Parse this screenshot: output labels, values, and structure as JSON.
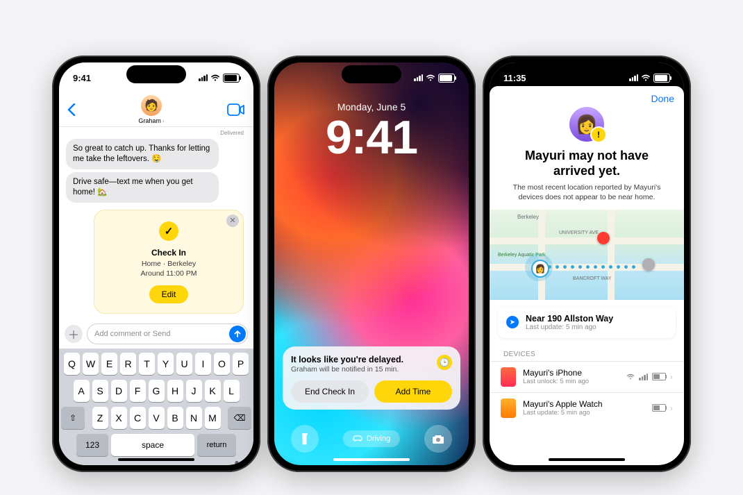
{
  "phone1": {
    "status": {
      "time": "9:41"
    },
    "contact_name": "Graham",
    "nav": {
      "back_aria": "Back",
      "video_aria": "FaceTime"
    },
    "delivered": "Delivered",
    "messages": [
      "So great to catch up. Thanks for letting me take the leftovers. 🤤",
      "Drive safe—text me when you get home! 🏡"
    ],
    "checkin": {
      "title": "Check In",
      "destination": "Home · Berkeley",
      "eta": "Around 11:00 PM",
      "edit": "Edit"
    },
    "compose": {
      "placeholder": "Add comment or Send"
    },
    "keyboard": {
      "row1": [
        "Q",
        "W",
        "E",
        "R",
        "T",
        "Y",
        "U",
        "I",
        "O",
        "P"
      ],
      "row2": [
        "A",
        "S",
        "D",
        "F",
        "G",
        "H",
        "J",
        "K",
        "L"
      ],
      "row3": [
        "Z",
        "X",
        "C",
        "V",
        "B",
        "N",
        "M"
      ],
      "shift": "⇧",
      "delete": "⌫",
      "numbers": "123",
      "space": "space",
      "return": "return"
    }
  },
  "phone2": {
    "status": {},
    "date": "Monday, June 5",
    "time": "9:41",
    "notification": {
      "title": "It looks like you're delayed.",
      "subtitle": "Graham will be notified in 15 min.",
      "end": "End Check In",
      "add": "Add Time"
    },
    "focus": "Driving",
    "buttons": {
      "flashlight_aria": "Flashlight",
      "camera_aria": "Camera"
    }
  },
  "phone3": {
    "status": {
      "time": "11:35"
    },
    "done": "Done",
    "title": "Mayuri may not have arrived yet.",
    "subtitle": "The most recent location reported by Mayuri's devices does not appear to be near home.",
    "map": {
      "city": "Berkeley",
      "park": "Berkeley Aquatic Park",
      "streets": [
        "UNIVERSITY AVE",
        "BANCROFT WAY"
      ]
    },
    "location": {
      "label": "Near 190 Allston Way",
      "updated": "Last update: 5 min ago"
    },
    "devices_header": "DEVICES",
    "devices": [
      {
        "name": "Mayuri's iPhone",
        "status": "Last unlock: 5 min ago",
        "has_wifi": true,
        "has_cell": true
      },
      {
        "name": "Mayuri's Apple Watch",
        "status": "Last update: 5 min ago",
        "has_wifi": false,
        "has_cell": false
      }
    ]
  }
}
